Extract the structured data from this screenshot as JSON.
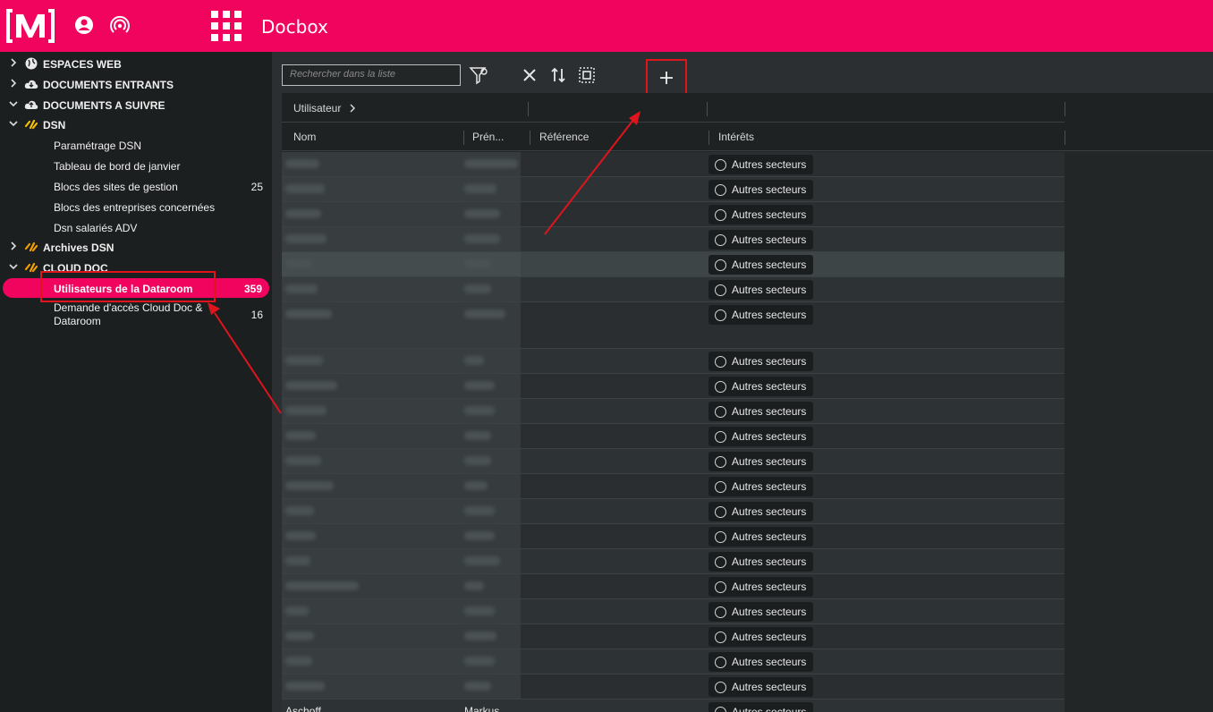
{
  "app": {
    "title": "Docbox",
    "brand_color": "#f0045e"
  },
  "topbar": {
    "icons": [
      "logo",
      "user-account-icon",
      "broadcast-icon",
      "apps-grid-icon"
    ]
  },
  "sidebar": {
    "items": [
      {
        "label": "ESPACES WEB",
        "icon": "globe-icon",
        "expanded": false,
        "level": 0
      },
      {
        "label": "DOCUMENTS ENTRANTS",
        "icon": "cloud-download-icon",
        "expanded": false,
        "level": 0
      },
      {
        "label": "DOCUMENTS A SUIVRE",
        "icon": "cloud-upload-icon",
        "expanded": true,
        "level": 0
      },
      {
        "label": "DSN",
        "icon": "dsn-icon",
        "expanded": true,
        "level": 0
      },
      {
        "label": "Paramétrage DSN",
        "level": 1,
        "count": ""
      },
      {
        "label": "Tableau de bord de janvier",
        "level": 1,
        "count": ""
      },
      {
        "label": "Blocs des sites de gestion",
        "level": 1,
        "count": "25"
      },
      {
        "label": "Blocs des entreprises concernées",
        "level": 1,
        "count": ""
      },
      {
        "label": "Dsn salariés ADV",
        "level": 1,
        "count": ""
      },
      {
        "label": "Archives DSN",
        "icon": "dsn-icon",
        "expanded": false,
        "level": 0
      },
      {
        "label": "CLOUD DOC",
        "icon": "dsn-icon",
        "expanded": true,
        "level": 0
      },
      {
        "label": "Utilisateurs de la Dataroom",
        "level": 1,
        "count": "359",
        "active": true
      },
      {
        "label_line1": "Demande d'accès Cloud Doc &",
        "label_line2": "Dataroom",
        "level": 1,
        "count": "16"
      }
    ]
  },
  "toolbar": {
    "search_placeholder": "Rechercher dans la liste",
    "buttons": [
      "filter-settings-icon",
      "clear-icon",
      "sort-icon",
      "select-all-icon",
      "add-icon"
    ],
    "add_label": "+"
  },
  "grid": {
    "group_label": "Utilisateur",
    "columns": [
      "Nom",
      "Prén...",
      "Référence",
      "Intérêts"
    ],
    "interest_value": "Autres secteurs",
    "rows_count_visible": 22,
    "last_row": {
      "nom": "Aschoff",
      "prenom": "Markus"
    },
    "selected_row_index": 4
  }
}
